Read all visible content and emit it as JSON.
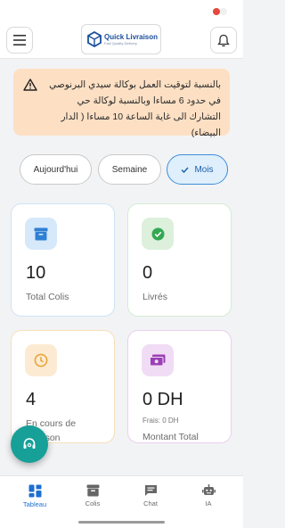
{
  "header": {
    "logo_title": "Quick Livraison",
    "logo_subtitle": "Fast Quality Delivery"
  },
  "alert": {
    "text": "بالنسبة لتوقيت العمل بوكالة سيدي البرنوصي في حدود 6 مساءا وبالنسبة لوكالة حي التشارك الى غاية الساعة 10 مساءا ( الدار البيضاء)"
  },
  "filters": {
    "today": "Aujourd'hui",
    "week": "Semaine",
    "month": "Mois",
    "selected": "Mois"
  },
  "cards": {
    "total": {
      "value": "10",
      "label": "Total Colis",
      "icon": "archive-icon",
      "color": "#2f7fd4"
    },
    "delivered": {
      "value": "0",
      "label": "Livrés",
      "icon": "check-circle-icon",
      "color": "#33a853"
    },
    "in_progress": {
      "value": "4",
      "label": "En cours de livraison",
      "icon": "clock-icon",
      "color": "#e8a43a"
    },
    "amount": {
      "value": "0 DH",
      "fees": "Frais: 0 DH",
      "label": "Montant Total",
      "icon": "money-icon",
      "color": "#9b3fb5"
    }
  },
  "bottom_nav": {
    "items": [
      {
        "label": "Tableau",
        "icon": "dashboard-icon",
        "active": true
      },
      {
        "label": "Colis",
        "icon": "archive-icon",
        "active": false
      },
      {
        "label": "Chat",
        "icon": "chat-icon",
        "active": false
      },
      {
        "label": "IA",
        "icon": "robot-icon",
        "active": false
      }
    ]
  }
}
